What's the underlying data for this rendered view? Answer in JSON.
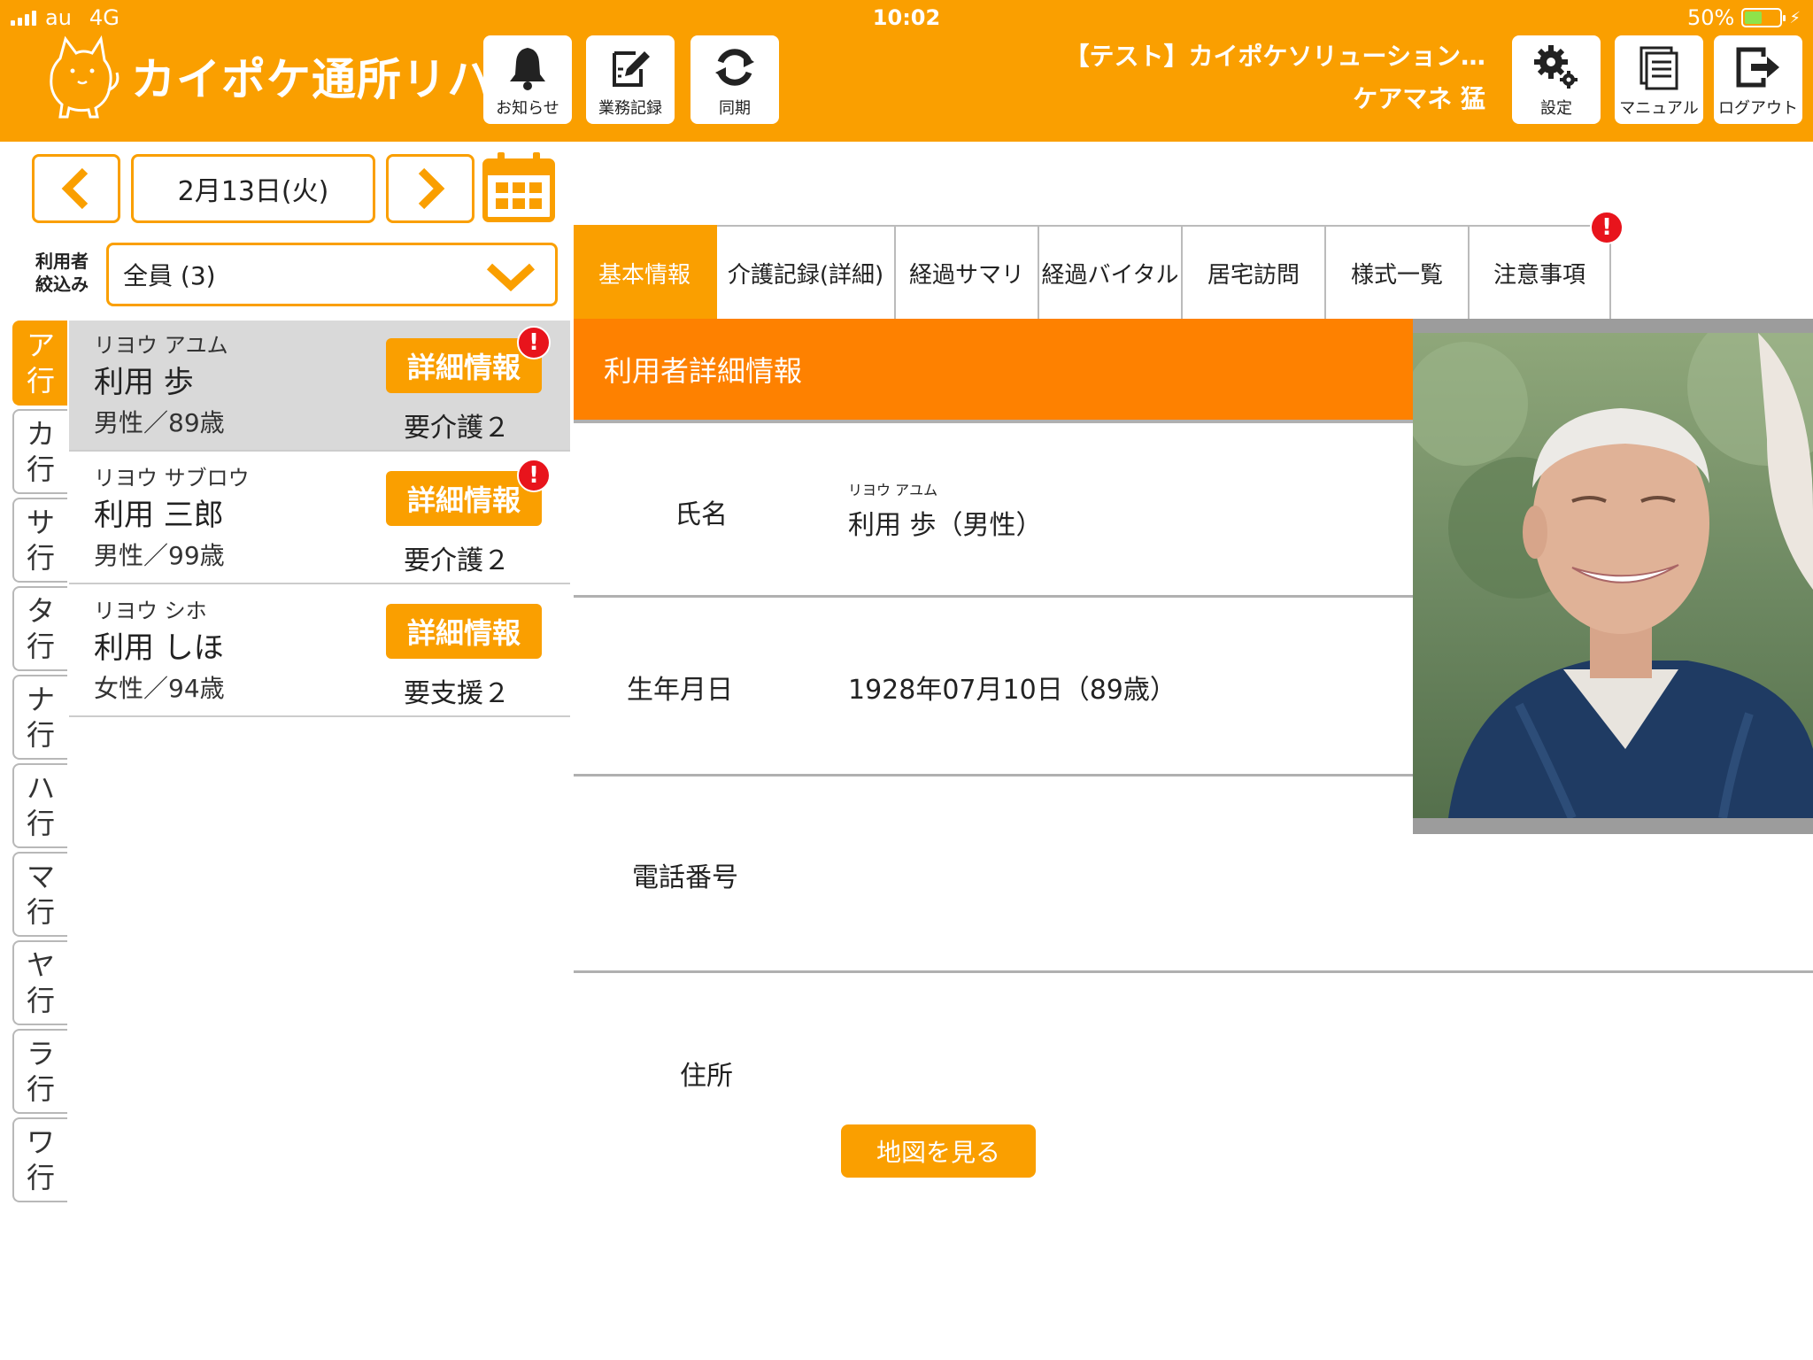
{
  "status_bar": {
    "carrier": "au",
    "network": "4G",
    "time": "10:02",
    "battery": "50%"
  },
  "header": {
    "app_name": "カイポケ通所リハ",
    "toolbar": [
      {
        "label": "お知らせ",
        "icon": "bell-icon"
      },
      {
        "label": "業務記録",
        "icon": "edit-icon"
      },
      {
        "label": "同期",
        "icon": "sync-icon"
      }
    ],
    "org_name": "【テスト】カイポケソリューション…",
    "user_name": "ケアマネ 猛",
    "right_buttons": [
      {
        "label": "設定",
        "icon": "gear-icon"
      },
      {
        "label": "マニュアル",
        "icon": "manual-icon"
      },
      {
        "label": "ログアウト",
        "icon": "logout-icon"
      }
    ]
  },
  "date_nav": {
    "date": "2月13日(火)"
  },
  "filter": {
    "label_line1": "利用者",
    "label_line2": "絞込み",
    "value": "全員 (3)"
  },
  "kana_tabs": [
    {
      "top": "ア",
      "bottom": "行"
    },
    {
      "top": "カ",
      "bottom": "行"
    },
    {
      "top": "サ",
      "bottom": "行"
    },
    {
      "top": "タ",
      "bottom": "行"
    },
    {
      "top": "ナ",
      "bottom": "行"
    },
    {
      "top": "ハ",
      "bottom": "行"
    },
    {
      "top": "マ",
      "bottom": "行"
    },
    {
      "top": "ヤ",
      "bottom": "行"
    },
    {
      "top": "ラ",
      "bottom": "行"
    },
    {
      "top": "ワ",
      "bottom": "行"
    }
  ],
  "users": [
    {
      "kana": "リヨウ アユム",
      "name": "利用 歩",
      "sex_age": "男性／89歳",
      "detail_label": "詳細情報",
      "care_level": "要介護２",
      "alert": "!"
    },
    {
      "kana": "リヨウ サブロウ",
      "name": "利用 三郎",
      "sex_age": "男性／99歳",
      "detail_label": "詳細情報",
      "care_level": "要介護２",
      "alert": "!"
    },
    {
      "kana": "リヨウ シホ",
      "name": "利用 しほ",
      "sex_age": "女性／94歳",
      "detail_label": "詳細情報",
      "care_level": "要支援２"
    }
  ],
  "tabs": [
    "基本情報",
    "介護記録(詳細)",
    "経過サマリ",
    "経過バイタル",
    "居宅訪問",
    "様式一覧",
    "注意事項"
  ],
  "tab_alert": "!",
  "detail": {
    "section_title": "利用者詳細情報",
    "name_label": "氏名",
    "name_ruby": "リヨウ アユム",
    "name_value": "利用 歩（男性）",
    "birth_label": "生年月日",
    "birth_value": "1928年07月10日（89歳）",
    "phone_label": "電話番号",
    "phone_value": "",
    "address_label": "住所",
    "map_button": "地図を見る"
  },
  "colors": {
    "brand": "#fa9f00",
    "section": "#fe8100",
    "alert": "#e8141c"
  }
}
